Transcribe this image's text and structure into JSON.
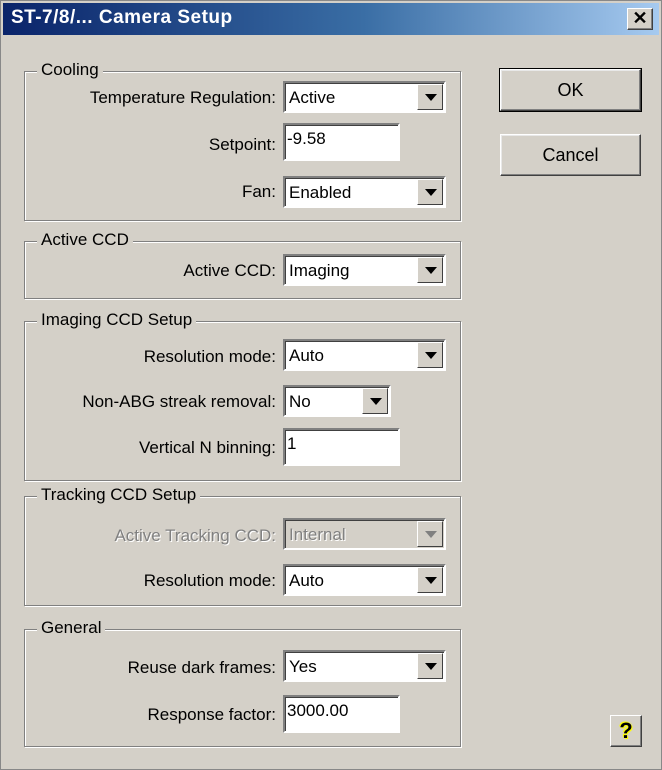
{
  "window": {
    "title": "ST-7/8/... Camera Setup",
    "close_glyph": "✕"
  },
  "buttons": {
    "ok": "OK",
    "cancel": "Cancel",
    "help_glyph": "?"
  },
  "cooling": {
    "title": "Cooling",
    "temp_label": "Temperature Regulation:",
    "temp_value": "Active",
    "setpoint_label": "Setpoint:",
    "setpoint_value": "-9.58",
    "fan_label": "Fan:",
    "fan_value": "Enabled"
  },
  "active_ccd": {
    "title": "Active CCD",
    "label": "Active CCD:",
    "value": "Imaging"
  },
  "imaging": {
    "title": "Imaging CCD Setup",
    "res_label": "Resolution mode:",
    "res_value": "Auto",
    "streak_label": "Non-ABG streak removal:",
    "streak_value": "No",
    "binning_label": "Vertical N binning:",
    "binning_value": "1"
  },
  "tracking": {
    "title": "Tracking CCD Setup",
    "active_label": "Active Tracking CCD:",
    "active_value": "Internal",
    "res_label": "Resolution mode:",
    "res_value": "Auto"
  },
  "general": {
    "title": "General",
    "reuse_label": "Reuse dark frames:",
    "reuse_value": "Yes",
    "response_label": "Response factor:",
    "response_value": "3000.00"
  }
}
